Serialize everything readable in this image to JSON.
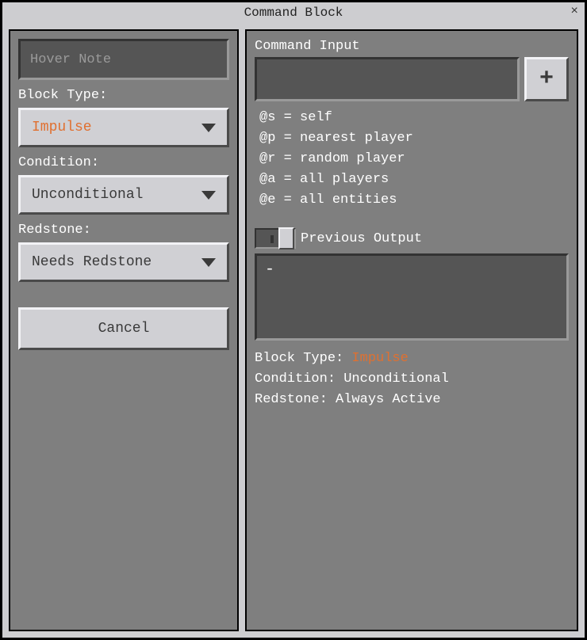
{
  "title": "Command Block",
  "left": {
    "hover_placeholder": "Hover Note",
    "block_type_label": "Block Type:",
    "block_type_value": "Impulse",
    "condition_label": "Condition:",
    "condition_value": "Unconditional",
    "redstone_label": "Redstone:",
    "redstone_value": "Needs Redstone",
    "cancel_label": "Cancel"
  },
  "right": {
    "command_input_label": "Command Input",
    "command_value": "",
    "plus_label": "+",
    "help_lines": {
      "l0": "@s = self",
      "l1": "@p = nearest player",
      "l2": "@r = random player",
      "l3": "@a = all players",
      "l4": "@e = all entities"
    },
    "previous_output_label": "Previous Output",
    "previous_output_value": "-",
    "status": {
      "block_type_label": "Block Type: ",
      "block_type_value": "Impulse",
      "condition_line": "Condition: Unconditional",
      "redstone_line": "Redstone: Always Active"
    }
  }
}
